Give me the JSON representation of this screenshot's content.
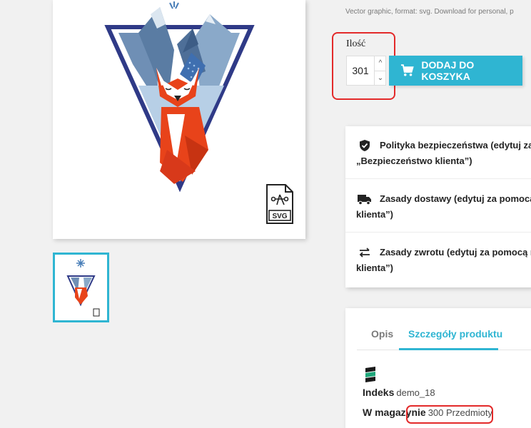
{
  "description_snippet": "Vector graphic, format: svg. Download for personal, p",
  "svg_badge_label": "SVG",
  "quantity": {
    "label": "Ilość",
    "value": "301",
    "increment_symbol": "^",
    "decrement_symbol": "⌄"
  },
  "add_to_cart_label": "DODAJ DO KOSZYKA",
  "reassurance": [
    {
      "icon": "shield-icon",
      "line1": "Polityka bezpieczeństwa (edytuj za p",
      "line2": "„Bezpieczeństwo klienta”)"
    },
    {
      "icon": "truck-icon",
      "line1": "Zasady dostawy (edytuj za pomocą n",
      "line2": "klienta”)"
    },
    {
      "icon": "exchange-arrows-icon",
      "line1": "Zasady zwrotu (edytuj za pomocą m",
      "line2": "klienta”)"
    }
  ],
  "tabs": [
    {
      "label": "Opis",
      "active": false
    },
    {
      "label": "Szczegóły produktu",
      "active": true
    }
  ],
  "details": {
    "reference_label": "Indeks",
    "reference_value": "demo_18",
    "stock_label": "W magazynie",
    "stock_value": "300 Przedmioty"
  },
  "colors": {
    "accent": "#2fb5d2",
    "highlight_outline": "#e32a2a",
    "triangle_border": "#2f3a87",
    "fox": "#e8431a"
  }
}
